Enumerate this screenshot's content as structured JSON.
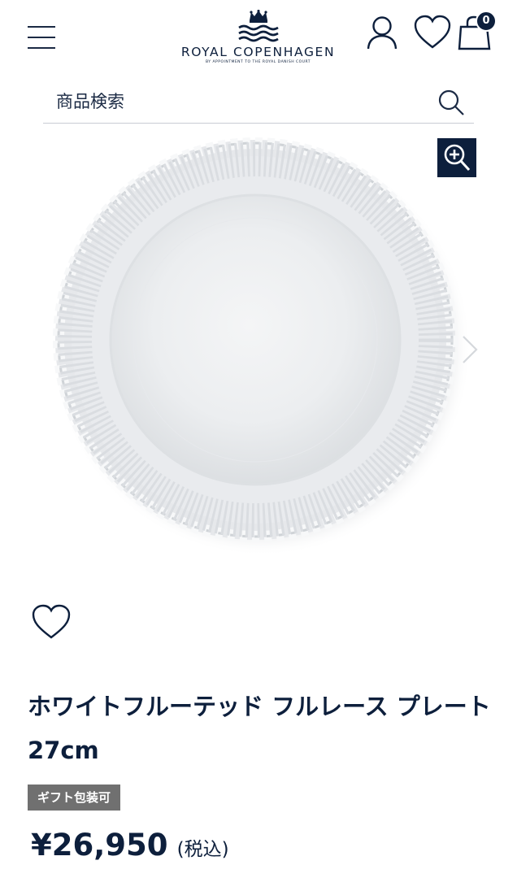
{
  "header": {
    "brand_name": "ROYAL COPENHAGEN",
    "brand_tagline": "BY APPOINTMENT TO THE ROYAL DANISH COURT",
    "cart_count": "0"
  },
  "search": {
    "placeholder": "商品検索"
  },
  "product": {
    "title": "ホワイトフルーテッド フルレース プレート 27cm",
    "gift_badge": "ギフト包装可",
    "price": "¥26,950",
    "tax_note": "(税込)"
  },
  "colors": {
    "navy": "#0d1f3c",
    "badge_gray": "#707070"
  },
  "icons": [
    "menu-icon",
    "account-icon",
    "heart-icon",
    "cart-icon",
    "search-icon",
    "zoom-in-icon",
    "chevron-right-icon"
  ]
}
